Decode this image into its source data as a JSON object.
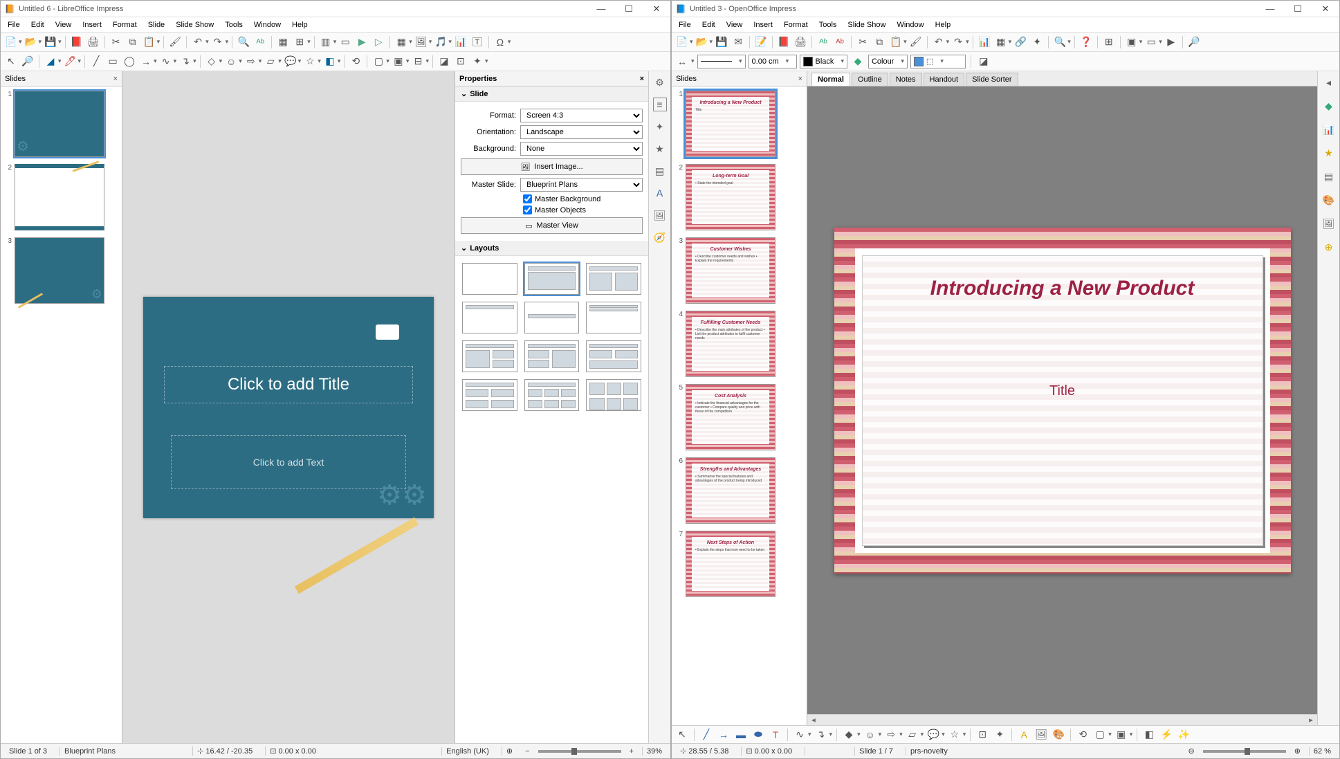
{
  "left": {
    "title": "Untitled 6 - LibreOffice Impress",
    "menus": [
      "File",
      "Edit",
      "View",
      "Insert",
      "Format",
      "Slide",
      "Slide Show",
      "Tools",
      "Window",
      "Help"
    ],
    "slidepanel_title": "Slides",
    "slide_title_placeholder": "Click to add Title",
    "slide_text_placeholder": "Click to add Text",
    "props_title": "Properties",
    "section_slide": "Slide",
    "section_layouts": "Layouts",
    "format_label": "Format:",
    "format_value": "Screen 4:3",
    "orientation_label": "Orientation:",
    "orientation_value": "Landscape",
    "background_label": "Background:",
    "background_value": "None",
    "insert_image_btn": "Insert Image...",
    "master_slide_label": "Master Slide:",
    "master_slide_value": "Blueprint Plans",
    "master_bg_chk": "Master Background",
    "master_obj_chk": "Master Objects",
    "master_view_btn": "Master View",
    "status_slide": "Slide 1 of 3",
    "status_template": "Blueprint Plans",
    "status_pos": "16.42 / -20.35",
    "status_size": "0.00 x 0.00",
    "status_lang": "English (UK)",
    "status_zoom": "39%",
    "thumbs": [
      1,
      2,
      3
    ]
  },
  "right": {
    "title": "Untitled 3 - OpenOffice Impress",
    "menus": [
      "File",
      "Edit",
      "View",
      "Insert",
      "Format",
      "Tools",
      "Slide Show",
      "Window",
      "Help"
    ],
    "slidepanel_title": "Slides",
    "line_width": "0.00 cm",
    "line_color": "Black",
    "fill_label": "Colour",
    "view_tabs": [
      "Normal",
      "Outline",
      "Notes",
      "Handout",
      "Slide Sorter"
    ],
    "slide_h1": "Introducing a New Product",
    "slide_sub": "Title",
    "thumbs": [
      {
        "n": 1,
        "title": "Introducing a New Product",
        "body": "Title"
      },
      {
        "n": 2,
        "title": "Long-term Goal",
        "body": "• State the intended goal"
      },
      {
        "n": 3,
        "title": "Customer Wishes",
        "body": "• Describe customer needs and wishes • Explain the requirements"
      },
      {
        "n": 4,
        "title": "Fulfilling Customer Needs",
        "body": "• Describe the main attributes of the product • List the product attributes to fulfil customer needs"
      },
      {
        "n": 5,
        "title": "Cost Analysis",
        "body": "• Indicate the financial advantages for the customer • Compare quality and price with those of the competition"
      },
      {
        "n": 6,
        "title": "Strengths and Advantages",
        "body": "• Summarise the special features and advantages of the product being introduced"
      },
      {
        "n": 7,
        "title": "Next Steps of Action",
        "body": "• Explain the steps that now need to be taken"
      }
    ],
    "status_pos": "28.55 / 5.38",
    "status_size": "0.00 x 0.00",
    "status_slide": "Slide 1 / 7",
    "status_template": "prs-novelty",
    "status_zoom": "62 %"
  }
}
